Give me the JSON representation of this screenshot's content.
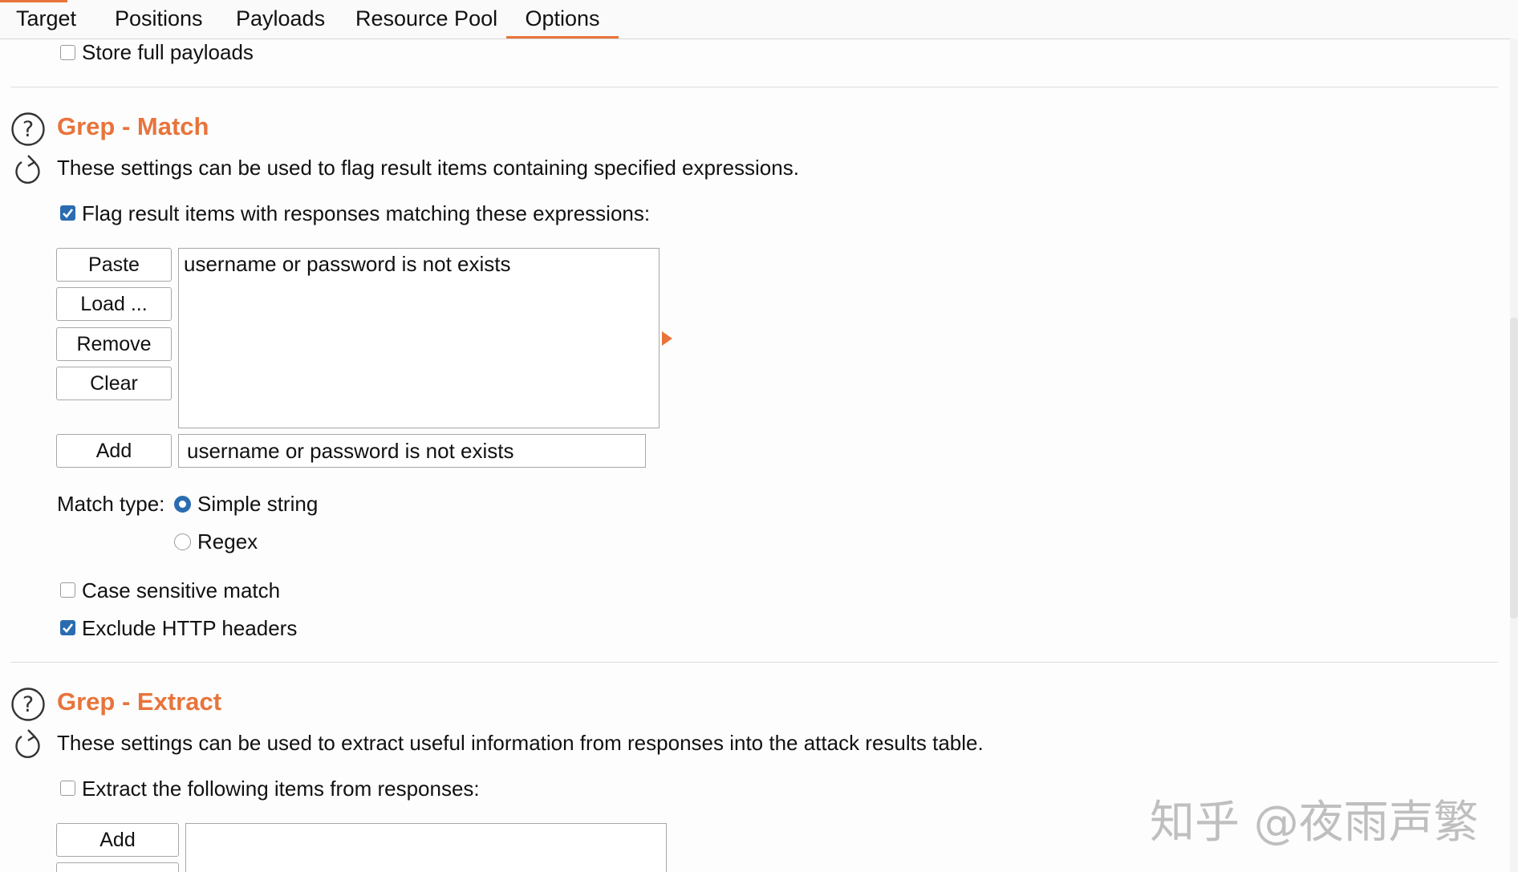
{
  "tabs": [
    {
      "label": "Target"
    },
    {
      "label": "Positions"
    },
    {
      "label": "Payloads"
    },
    {
      "label": "Resource Pool"
    },
    {
      "label": "Options"
    }
  ],
  "active_tab": "Options",
  "store_full_payloads": {
    "label": "Store full payloads",
    "checked": false
  },
  "grep_match": {
    "title": "Grep - Match",
    "description": "These settings can be used to flag result items containing specified expressions.",
    "flag_checkbox": {
      "label": "Flag result items with responses matching these expressions:",
      "checked": true
    },
    "buttons": {
      "paste": "Paste",
      "load": "Load ...",
      "remove": "Remove",
      "clear": "Clear",
      "add": "Add"
    },
    "list_items": [
      "username or password is not exists"
    ],
    "add_input_value": "username or password is not exists",
    "match_type_label": "Match type:",
    "match_types": {
      "simple": "Simple string",
      "regex": "Regex"
    },
    "selected_match_type": "Simple string",
    "case_sensitive": {
      "label": "Case sensitive match",
      "checked": false
    },
    "exclude_headers": {
      "label": "Exclude HTTP headers",
      "checked": true
    }
  },
  "grep_extract": {
    "title": "Grep - Extract",
    "description": "These settings can be used to extract useful information from responses into the attack results table.",
    "extract_checkbox": {
      "label": "Extract the following items from responses:",
      "checked": false
    },
    "buttons": {
      "add": "Add"
    }
  },
  "watermark": "知乎 @夜雨声繁",
  "colors": {
    "accent": "#e8743b",
    "check": "#2b6cb0"
  }
}
